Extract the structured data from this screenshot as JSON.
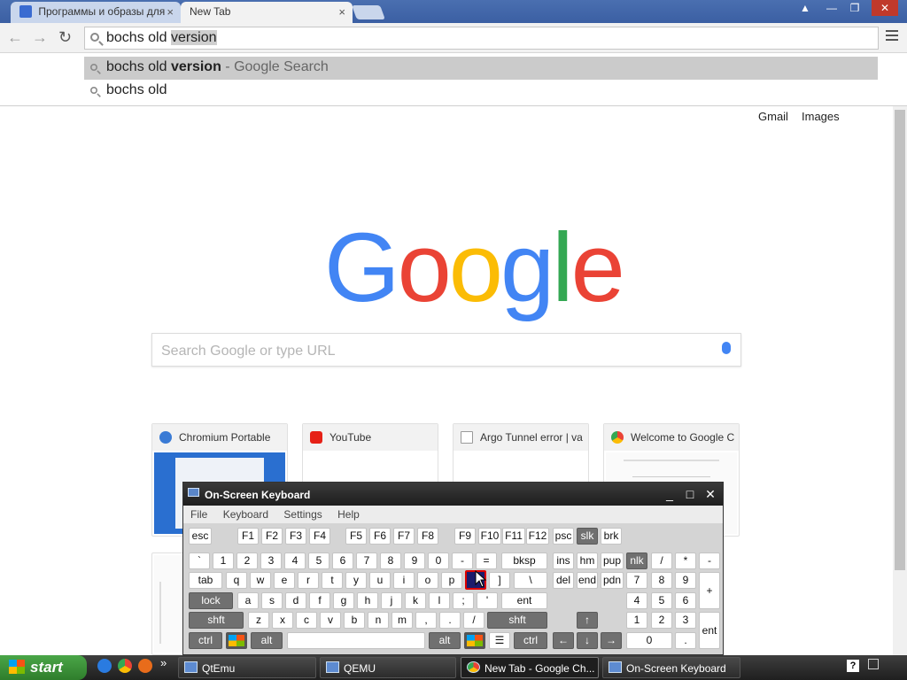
{
  "browser": {
    "tabs": [
      {
        "label": "Программы и образы для",
        "close": "×"
      },
      {
        "label": "New Tab",
        "close": "×"
      }
    ],
    "window_buttons": [
      "▲",
      "—",
      "❐",
      "✕"
    ],
    "omnibox": {
      "typed": "bochs old ",
      "selected": "version"
    },
    "suggestions": [
      {
        "normal": "bochs old ",
        "bold": "version",
        "suffix": " - Google Search"
      },
      {
        "normal": "bochs old",
        "bold": "",
        "suffix": ""
      }
    ]
  },
  "newtab": {
    "links": [
      "Gmail",
      "Images"
    ],
    "logo_letters": [
      {
        "ch": "G",
        "color": "#4285F4"
      },
      {
        "ch": "o",
        "color": "#EA4335"
      },
      {
        "ch": "o",
        "color": "#FBBC05"
      },
      {
        "ch": "g",
        "color": "#4285F4"
      },
      {
        "ch": "l",
        "color": "#34A853"
      },
      {
        "ch": "e",
        "color": "#EA4335"
      }
    ],
    "search_placeholder": "Search Google or type URL",
    "tiles": [
      {
        "title": "Chromium Portable"
      },
      {
        "title": "YouTube"
      },
      {
        "title": "Argo Tunnel error | va"
      },
      {
        "title": "Welcome to Google C"
      }
    ]
  },
  "osk": {
    "title": "On-Screen Keyboard",
    "buttons": [
      "_",
      "□",
      "✕"
    ],
    "menu": [
      "File",
      "Keyboard",
      "Settings",
      "Help"
    ],
    "rows": [
      [
        "esc",
        "F1",
        "F2",
        "F3",
        "F4",
        "F5",
        "F6",
        "F7",
        "F8",
        "F9",
        "F10",
        "F11",
        "F12",
        "psc",
        "slk",
        "brk"
      ],
      [
        "`",
        "1",
        "2",
        "3",
        "4",
        "5",
        "6",
        "7",
        "8",
        "9",
        "0",
        "-",
        "=",
        "bksp",
        "ins",
        "hm",
        "pup",
        "nlk",
        "/",
        "*",
        "-"
      ],
      [
        "tab",
        "q",
        "w",
        "e",
        "r",
        "t",
        "y",
        "u",
        "i",
        "o",
        "p",
        "[",
        "]",
        "\\",
        "del",
        "end",
        "pdn",
        "7",
        "8",
        "9",
        "+"
      ],
      [
        "lock",
        "a",
        "s",
        "d",
        "f",
        "g",
        "h",
        "j",
        "k",
        "l",
        ";",
        "'",
        "ent",
        "4",
        "5",
        "6"
      ],
      [
        "shft",
        "z",
        "x",
        "c",
        "v",
        "b",
        "n",
        "m",
        ",",
        ".",
        "/",
        "shft",
        "↑",
        "1",
        "2",
        "3",
        "ent"
      ],
      [
        "ctrl",
        "alt",
        "alt",
        "ctrl",
        "←",
        "↓",
        "→",
        "0",
        "."
      ]
    ]
  },
  "taskbar": {
    "start": "start",
    "tasks": [
      "QtEmu",
      "QEMU",
      "New Tab - Google Ch...",
      "On-Screen Keyboard"
    ],
    "chevron": "»",
    "help": "?"
  }
}
